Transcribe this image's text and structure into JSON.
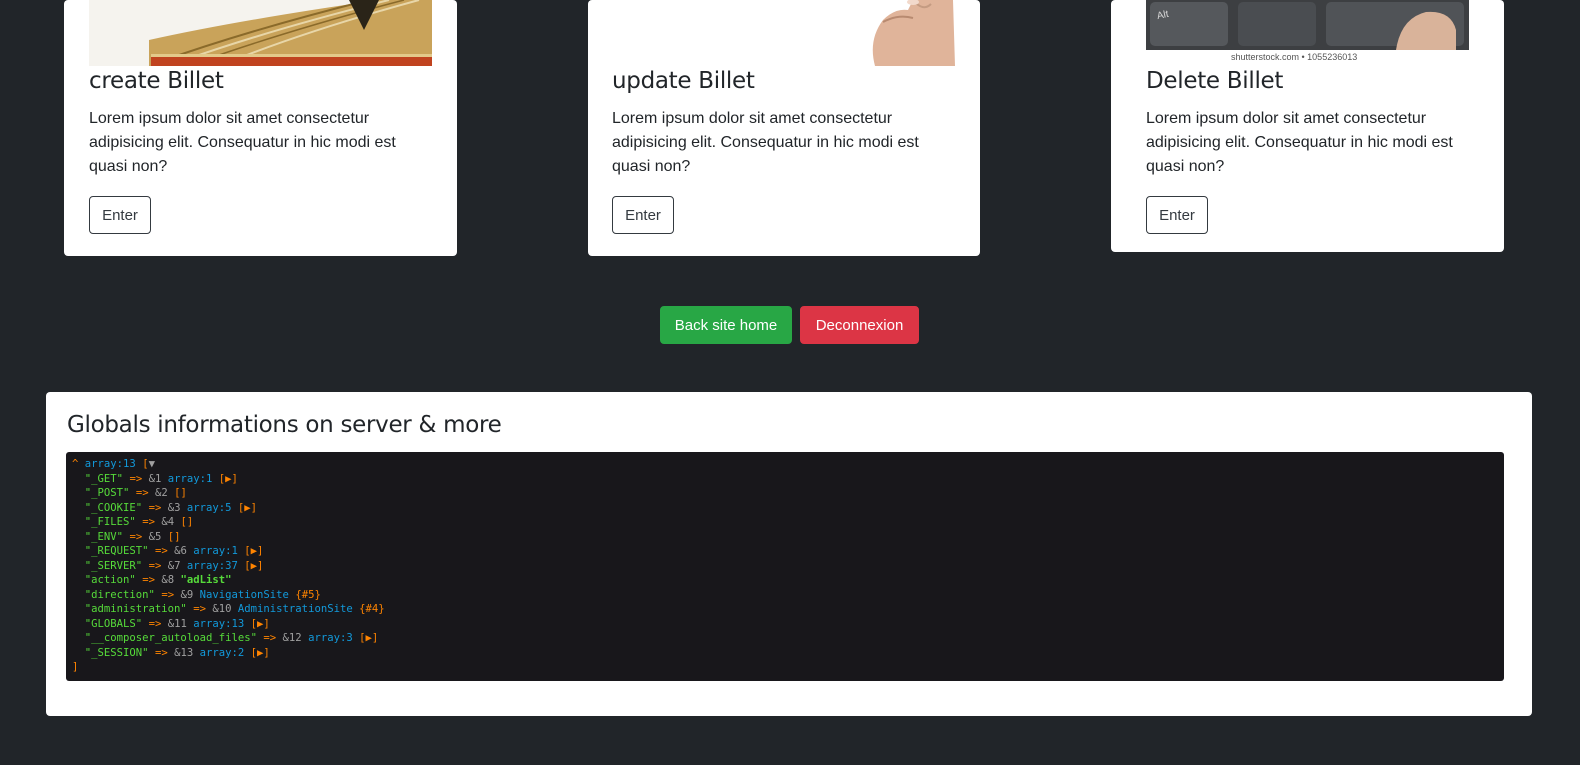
{
  "cards": [
    {
      "title": "create Billet",
      "text": "Lorem ipsum dolor sit amet consectetur adipisicing elit. Consequatur in hic modi est quasi non?",
      "button": "Enter"
    },
    {
      "title": "update Billet",
      "text": "Lorem ipsum dolor sit amet consectetur adipisicing elit. Consequatur in hic modi est quasi non?",
      "button": "Enter"
    },
    {
      "title": "Delete Billet",
      "text": "Lorem ipsum dolor sit amet consectetur adipisicing elit. Consequatur in hic modi est quasi non?",
      "button": "Enter",
      "image_caption": "shutterstock.com • 1055236013",
      "key_label": "Alt"
    }
  ],
  "actions": {
    "back_label": "Back site home",
    "logout_label": "Deconnexion"
  },
  "globals": {
    "title": "Globals informations on server & more",
    "dump": {
      "head": {
        "caret": "^",
        "type": "array:13",
        "open": "[",
        "toggle": "▼"
      },
      "lines": [
        {
          "key": "\"_GET\"",
          "arrow": "=>",
          "ref": "&1",
          "type": "array:1",
          "tail": "[▶]"
        },
        {
          "key": "\"_POST\"",
          "arrow": "=>",
          "ref": "&2",
          "type": "",
          "tail": "[]"
        },
        {
          "key": "\"_COOKIE\"",
          "arrow": "=>",
          "ref": "&3",
          "type": "array:5",
          "tail": "[▶]"
        },
        {
          "key": "\"_FILES\"",
          "arrow": "=>",
          "ref": "&4",
          "type": "",
          "tail": "[]"
        },
        {
          "key": "\"_ENV\"",
          "arrow": "=>",
          "ref": "&5",
          "type": "",
          "tail": "[]"
        },
        {
          "key": "\"_REQUEST\"",
          "arrow": "=>",
          "ref": "&6",
          "type": "array:1",
          "tail": "[▶]"
        },
        {
          "key": "\"_SERVER\"",
          "arrow": "=>",
          "ref": "&7",
          "type": "array:37",
          "tail": "[▶]"
        },
        {
          "key": "\"action\"",
          "arrow": "=>",
          "ref": "&8",
          "string": "\"adList\""
        },
        {
          "key": "\"direction\"",
          "arrow": "=>",
          "ref": "&9",
          "type": "NavigationSite",
          "tail": "{#5}"
        },
        {
          "key": "\"administration\"",
          "arrow": "=>",
          "ref": "&10",
          "type": "AdministrationSite",
          "tail": "{#4}"
        },
        {
          "key": "\"GLOBALS\"",
          "arrow": "=>",
          "ref": "&11",
          "type": "array:13",
          "tail": "[▶]"
        },
        {
          "key": "\"__composer_autoload_files\"",
          "arrow": "=>",
          "ref": "&12",
          "type": "array:3",
          "tail": "[▶]"
        },
        {
          "key": "\"_SESSION\"",
          "arrow": "=>",
          "ref": "&13",
          "type": "array:2",
          "tail": "[▶]"
        }
      ],
      "close": "]"
    }
  }
}
